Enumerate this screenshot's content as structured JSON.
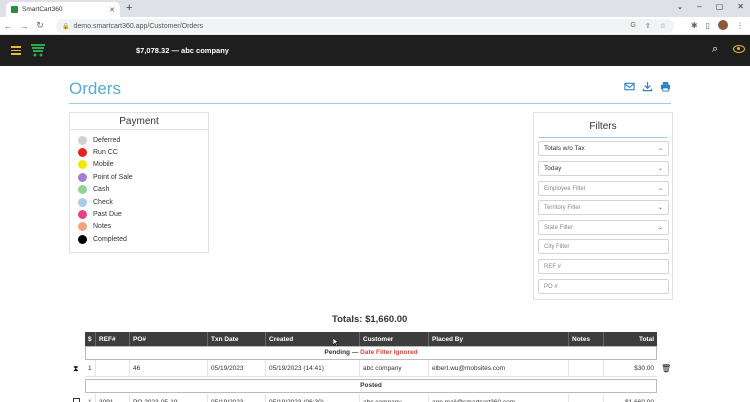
{
  "browser": {
    "tab_title": "SmartCart360",
    "url": "demo.smartcart360.app/Customer/Orders"
  },
  "header": {
    "balance_company": "$7,078.32 — abc company"
  },
  "page": {
    "title": "Orders"
  },
  "payment": {
    "title": "Payment",
    "items": [
      {
        "label": "Deferred",
        "color": "#cfcfcf"
      },
      {
        "label": "Run CC",
        "color": "#e3261b"
      },
      {
        "label": "Mobile",
        "color": "#f5e60d"
      },
      {
        "label": "Point of Sale",
        "color": "#a27fd4"
      },
      {
        "label": "Cash",
        "color": "#8fd694"
      },
      {
        "label": "Check",
        "color": "#a8cde8"
      },
      {
        "label": "Past Due",
        "color": "#e8417f"
      },
      {
        "label": "Notes",
        "color": "#f5a37a"
      },
      {
        "label": "Completed",
        "color": "#000000"
      }
    ]
  },
  "filters": {
    "title": "Filters",
    "totals_select": "Totals w/o Tax",
    "date_select": "Today",
    "employee": "Employee Filter",
    "territory": "Territory Filter",
    "state": "State Filter",
    "city_placeholder": "City Filter",
    "ref_placeholder": "REF #",
    "po_placeholder": "PO #"
  },
  "totals": "Totals: $1,660.00",
  "table": {
    "headers": [
      "$",
      "REF#",
      "PO#",
      "Txn Date",
      "Created",
      "Customer",
      "Placed By",
      "Notes",
      "Total"
    ],
    "pending_label": "Pending —",
    "pending_note": "Date Filter Ignored",
    "posted_label": "Posted",
    "rows": [
      {
        "n": "1",
        "ref": "",
        "po": "46",
        "txn": "05/19/2023",
        "created": "05/19/2023 (14:41)",
        "customer": "abc company",
        "placed_by": "elbert.wu@mobsites.com",
        "notes": "",
        "total": "$30.00"
      },
      {
        "n": "1",
        "ref": "3091",
        "po": "PO 2023-05-19",
        "txn": "05/19/2023",
        "created": "05/19/2023 (06:30)",
        "customer": "abc company",
        "placed_by": "app.mail@smartcart360.com",
        "notes": "",
        "total": "$1,660.00"
      }
    ]
  }
}
